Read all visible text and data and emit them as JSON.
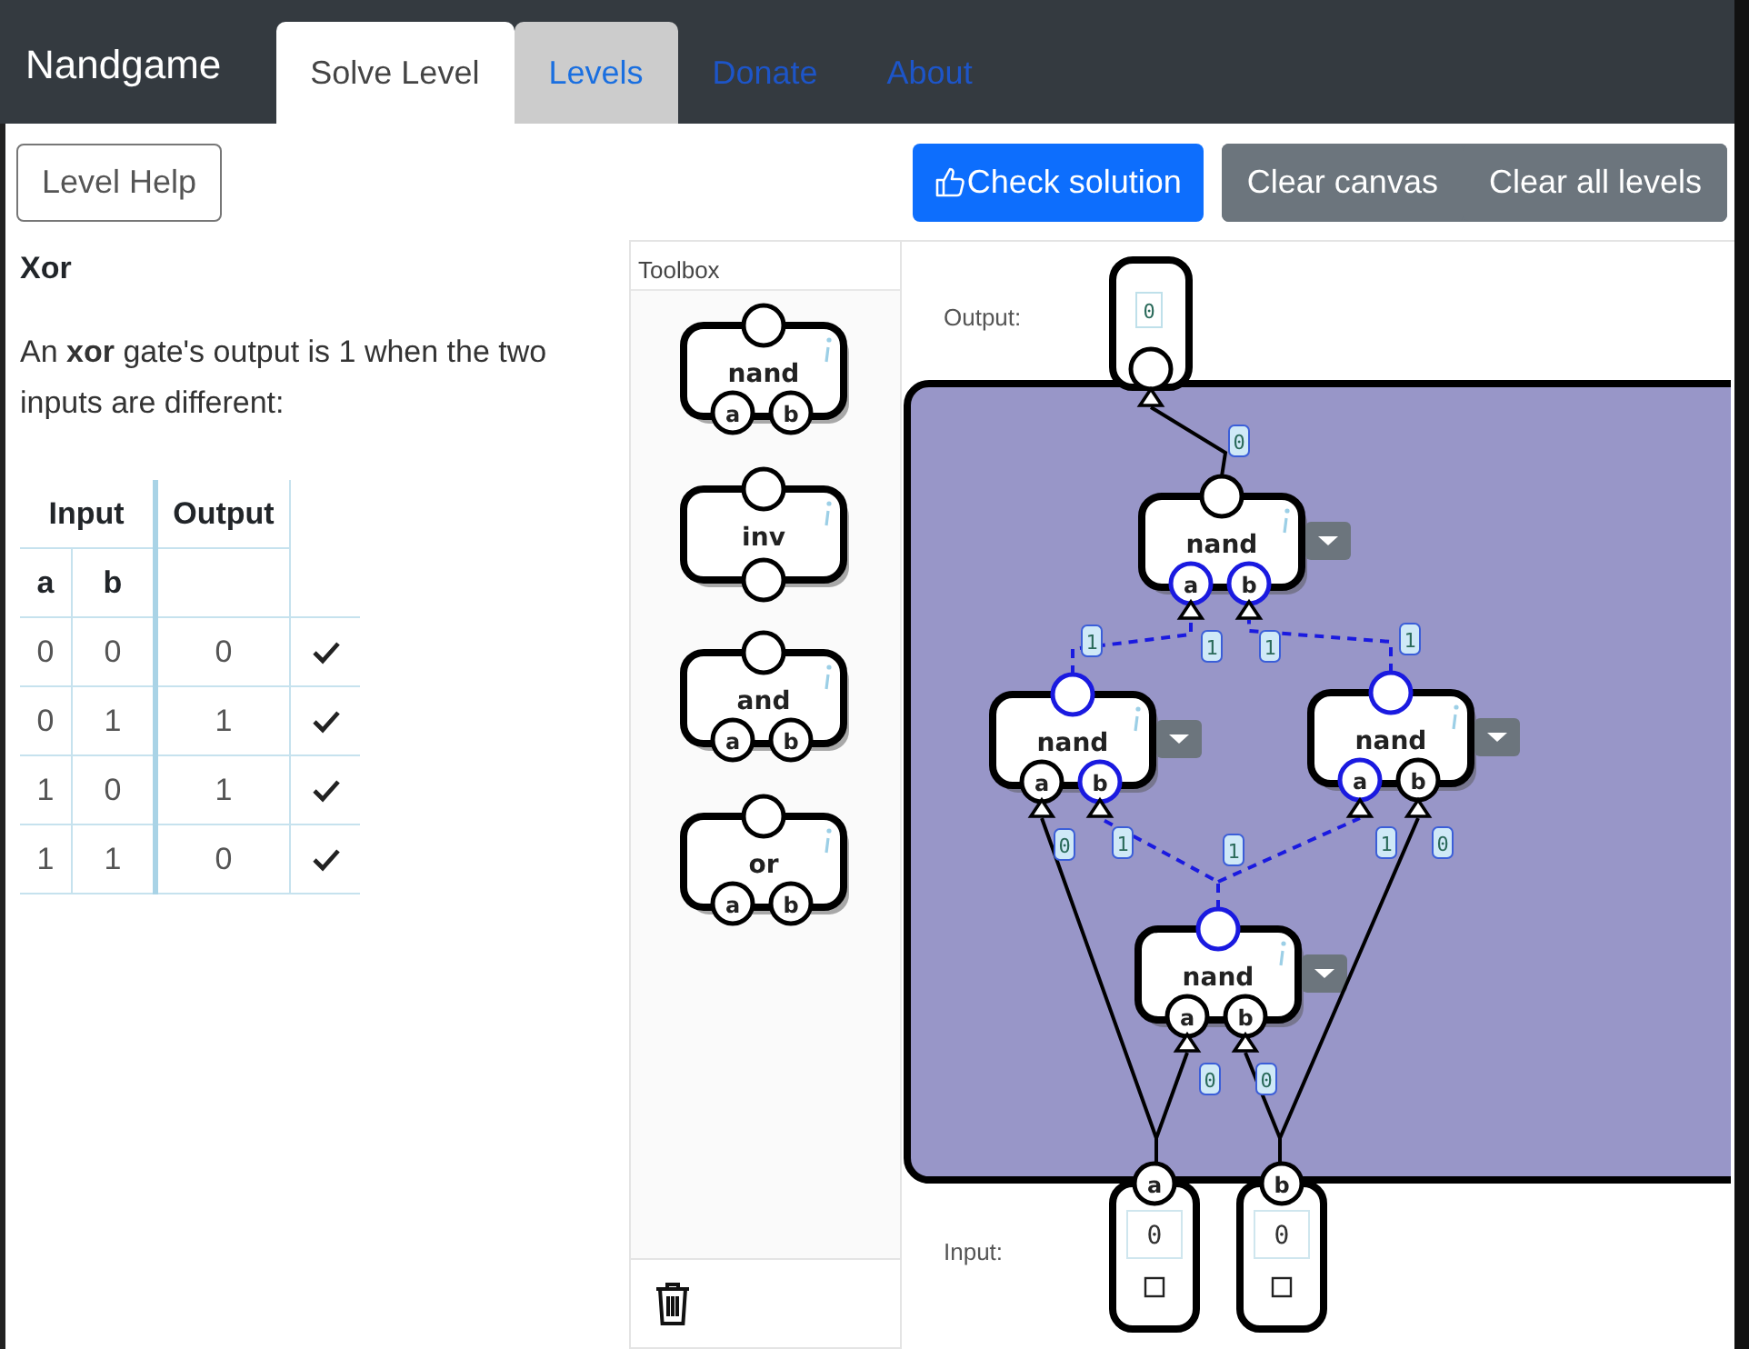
{
  "navbar": {
    "brand": "Nandgame",
    "tabs": [
      {
        "label": "Solve Level",
        "kind": "tab",
        "selected": true
      },
      {
        "label": "Levels",
        "kind": "tab",
        "selected": false
      },
      {
        "label": "Donate",
        "kind": "link",
        "selected": false
      },
      {
        "label": "About",
        "kind": "link",
        "selected": false
      }
    ]
  },
  "toolbar": {
    "help_button": "Level Help",
    "check_button": "Check solution",
    "clear_buttons": [
      "Clear canvas",
      "Clear all levels"
    ]
  },
  "level": {
    "title": "Xor",
    "description": "An **xor** gate's output is 1 when the two inputs are different:",
    "truth_table": {
      "input_header": "Input",
      "output_header": "Output",
      "input_names": [
        "a",
        "b"
      ],
      "rows": [
        {
          "a": "0",
          "b": "0",
          "output": "0",
          "passed": true
        },
        {
          "a": "0",
          "b": "1",
          "output": "1",
          "passed": true
        },
        {
          "a": "1",
          "b": "0",
          "output": "1",
          "passed": true
        },
        {
          "a": "1",
          "b": "1",
          "output": "0",
          "passed": true
        }
      ]
    }
  },
  "toolbox": {
    "title": "Toolbox",
    "gates": [
      {
        "name": "nand",
        "kind": "two_input",
        "inputs": [
          "a",
          "b"
        ]
      },
      {
        "name": "inv",
        "kind": "single_input"
      },
      {
        "name": "and",
        "kind": "two_input",
        "inputs": [
          "a",
          "b"
        ]
      },
      {
        "name": "or",
        "kind": "two_input",
        "inputs": [
          "a",
          "b"
        ]
      }
    ]
  },
  "canvas": {
    "output_label": "Output:",
    "input_label": "Input:",
    "output": {
      "value": "0",
      "high": false
    },
    "inputs": [
      {
        "name": "a",
        "value": "0",
        "checked": false,
        "high": false
      },
      {
        "name": "b",
        "value": "0",
        "checked": false,
        "high": false
      }
    ],
    "gates": [
      {
        "name": "nand",
        "output_high": false,
        "inputs": [
          {
            "name": "a",
            "high": true
          },
          {
            "name": "b",
            "high": true
          }
        ]
      },
      {
        "name": "nand",
        "output_high": true,
        "inputs": [
          {
            "name": "a",
            "high": false
          },
          {
            "name": "b",
            "high": true
          }
        ]
      },
      {
        "name": "nand",
        "output_high": true,
        "inputs": [
          {
            "name": "a",
            "high": true
          },
          {
            "name": "b",
            "high": false
          }
        ]
      },
      {
        "name": "nand",
        "output_high": true,
        "inputs": [
          {
            "name": "a",
            "high": false
          },
          {
            "name": "b",
            "high": false
          }
        ]
      }
    ],
    "wires": [
      {
        "high": false,
        "source_value": "0"
      },
      {
        "high": true,
        "source_value": "1",
        "target_value": "1"
      },
      {
        "high": true,
        "source_value": "1",
        "target_value": "1"
      },
      {
        "high": false,
        "target_value": "0"
      },
      {
        "high": true,
        "source_value": "1",
        "target_value": "1"
      },
      {
        "high": true,
        "target_value": "1"
      },
      {
        "high": false,
        "target_value": "0"
      },
      {
        "high": false,
        "target_value": "0"
      },
      {
        "high": false,
        "target_value": "0"
      }
    ]
  }
}
